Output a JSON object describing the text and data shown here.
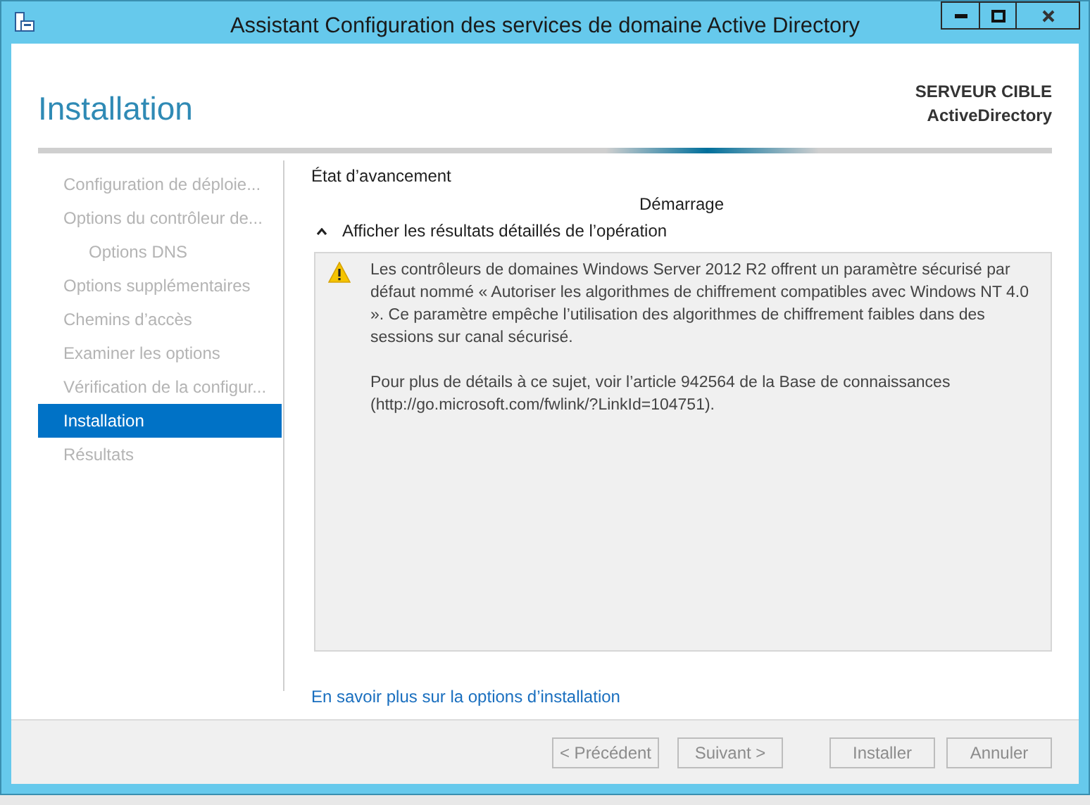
{
  "window": {
    "title": "Assistant Configuration des services de domaine Active Directory"
  },
  "header": {
    "title": "Installation",
    "server_label": "SERVEUR CIBLE",
    "server_name": "ActiveDirectory"
  },
  "sidebar": {
    "items": [
      {
        "label": "Configuration de déploie...",
        "selected": false
      },
      {
        "label": "Options du contrôleur de...",
        "selected": false,
        "children": [
          {
            "label": "Options DNS",
            "selected": false
          }
        ]
      },
      {
        "label": "Options supplémentaires",
        "selected": false
      },
      {
        "label": "Chemins d’accès",
        "selected": false
      },
      {
        "label": "Examiner les options",
        "selected": false
      },
      {
        "label": "Vérification de la configur...",
        "selected": false
      },
      {
        "label": "Installation",
        "selected": true
      },
      {
        "label": "Résultats",
        "selected": false
      }
    ]
  },
  "content": {
    "progress_label": "État d’avancement",
    "status": "Démarrage",
    "details_toggle": {
      "label": "Afficher les résultats détaillés de l’opération",
      "expanded": true
    },
    "messages": [
      {
        "kind": "warning",
        "paragraphs": [
          "Les contrôleurs de domaines Windows Server 2012 R2 offrent un paramètre sécurisé par défaut nommé « Autoriser les algorithmes de chiffrement compatibles avec Windows NT 4.0 ». Ce paramètre empêche l’utilisation des algorithmes de chiffrement faibles dans des sessions sur canal sécurisé.",
          "Pour plus de détails à ce sujet, voir l’article 942564 de la Base de connaissances (http://go.microsoft.com/fwlink/?LinkId=104751)."
        ]
      }
    ],
    "link": "En savoir plus sur la options d’installation"
  },
  "buttons": [
    {
      "label": "< Précédent",
      "disabled": true
    },
    {
      "label": "Suivant >",
      "disabled": true
    },
    {
      "label": "Installer",
      "disabled": true
    },
    {
      "label": "Annuler",
      "disabled": true
    }
  ]
}
